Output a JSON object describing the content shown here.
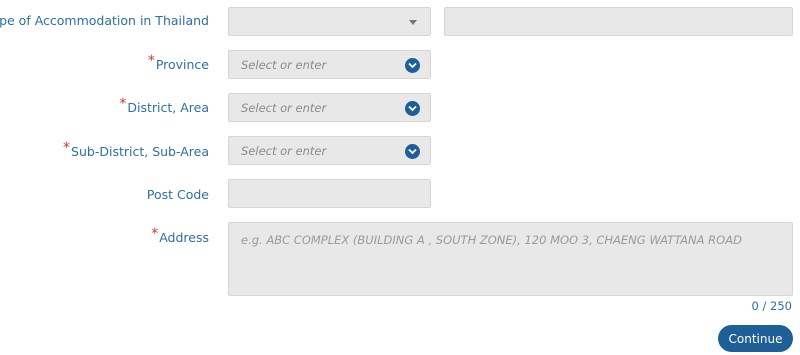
{
  "fields": {
    "accommodation": {
      "label": "Type of Accommodation in Thailand"
    },
    "province": {
      "label": "Province",
      "placeholder": "Select or enter"
    },
    "district": {
      "label": "District, Area",
      "placeholder": "Select or enter"
    },
    "subdistrict": {
      "label": "Sub-District, Sub-Area",
      "placeholder": "Select or enter"
    },
    "postcode": {
      "label": "Post Code"
    },
    "address": {
      "label": "Address",
      "placeholder": "e.g. ABC COMPLEX (BUILDING A , SOUTH ZONE), 120 MOO 3, CHAENG WATTANA ROAD"
    }
  },
  "required_mark": "*",
  "counter": "0 / 250",
  "continue_label": "Continue",
  "colors": {
    "label": "#2d6fa6",
    "required": "#d9352c",
    "accent": "#1f5f98",
    "field_bg": "#e8e8e8"
  },
  "icons": {
    "dropdown": "chevron-down-icon",
    "caret": "caret-down-icon"
  }
}
